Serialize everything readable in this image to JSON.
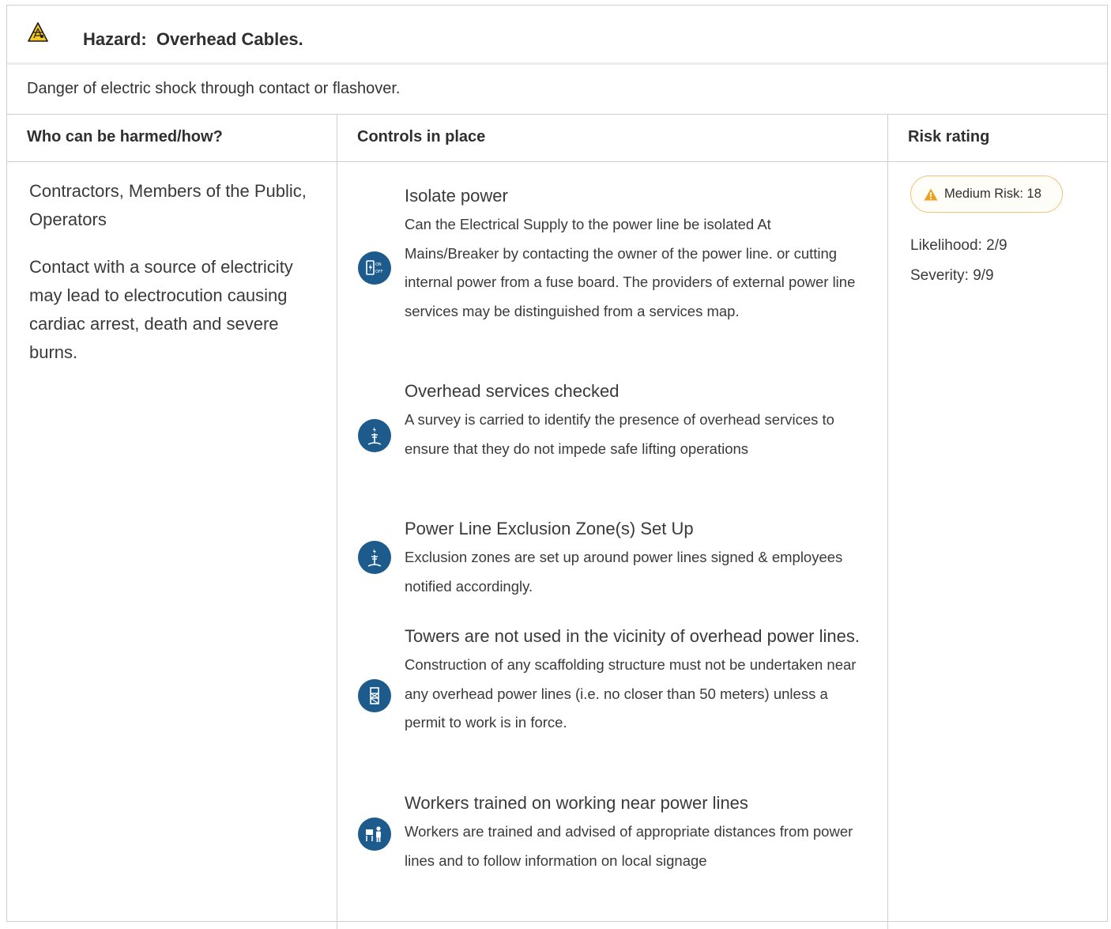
{
  "hazard": {
    "title": "Hazard:  Overhead Cables.",
    "description": "Danger of electric shock through contact or flashover.",
    "icon": "overhead-cable-hazard-icon"
  },
  "columns": {
    "who": "Who can be harmed/how?",
    "controls": "Controls in place",
    "risk": "Risk rating"
  },
  "harm": {
    "people": "Contractors, Members of the Public, Operators",
    "description": "Contact with a source of electricity may lead to electrocution causing cardiac arrest, death and severe burns."
  },
  "controls": [
    {
      "title": "Isolate power",
      "description": "Can the Electrical Supply to the power line be isolated At Mains/Breaker by contacting the owner of the power line. or cutting internal power from a fuse board. The providers of external power line services may be distinguished from a services map.",
      "icon": "power-switch-icon"
    },
    {
      "title": "Overhead services checked",
      "description": "A survey is carried to identify the presence of overhead services to ensure that they do not impede safe lifting operations",
      "icon": "power-pylon-icon"
    },
    {
      "title": "Power Line Exclusion Zone(s) Set Up",
      "description": "Exclusion zones are set up around power lines signed & employees notified accordingly.",
      "icon": "power-pylon-icon"
    },
    {
      "title": "Towers are not used in the vicinity of overhead power lines.",
      "description": "Construction of any scaffolding structure must not be undertaken near any overhead power lines (i.e. no closer than 50 meters) unless a permit to work is in force.",
      "icon": "scaffold-tower-icon"
    },
    {
      "title": "Workers trained on working near power lines",
      "description": "Workers are trained and advised of appropriate distances from power lines and to follow information on local signage",
      "icon": "worker-training-icon"
    }
  ],
  "risk": {
    "badge": "Medium Risk: 18",
    "likelihood": "Likelihood: 2/9",
    "severity": "Severity: 9/9",
    "color": "#f0a020"
  },
  "colors": {
    "icon_blue": "#1d5b8c",
    "border": "#cfcfcf",
    "warning_yellow": "#f7c81e"
  }
}
